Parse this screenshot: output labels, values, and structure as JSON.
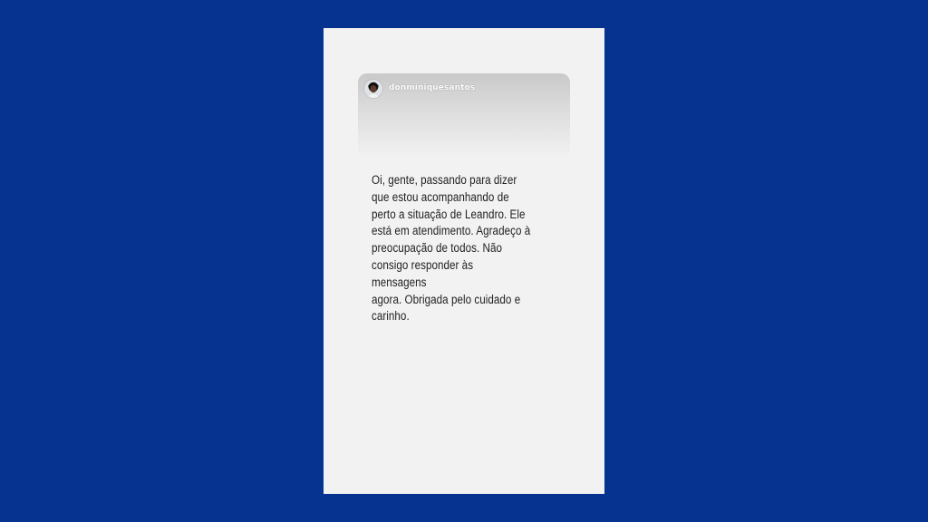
{
  "background_color": "#06338f",
  "story": {
    "username": "donminiquesantos",
    "avatar_icon": "profile-avatar-icon",
    "card_background": "#f2f2f2",
    "message_lines": [
      "Oi, gente, passando para dizer",
      "que estou acompanhando de",
      "perto a situação de Leandro. Ele",
      "está em atendimento. Agradeço à",
      "preocupação de todos. Não",
      "consigo responder às mensagens",
      "agora. Obrigada pelo cuidado e",
      "carinho."
    ]
  }
}
